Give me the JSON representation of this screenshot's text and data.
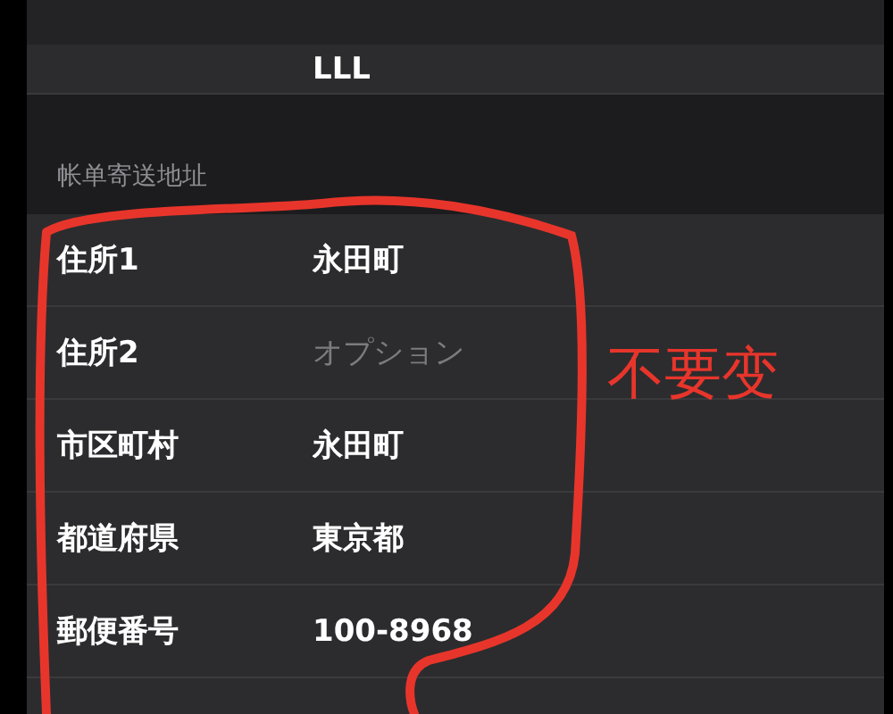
{
  "top_row": {
    "value": "LLL"
  },
  "section": {
    "title": "帐单寄送地址"
  },
  "fields": [
    {
      "label": "住所1",
      "value": "永田町"
    },
    {
      "label": "住所2",
      "placeholder": "オプション"
    },
    {
      "label": "市区町村",
      "value": "永田町"
    },
    {
      "label": "都道府県",
      "value": "東京都"
    },
    {
      "label": "郵便番号",
      "value": "100-8968"
    }
  ],
  "annotation": {
    "text": "不要变",
    "color": "#e8352b"
  }
}
